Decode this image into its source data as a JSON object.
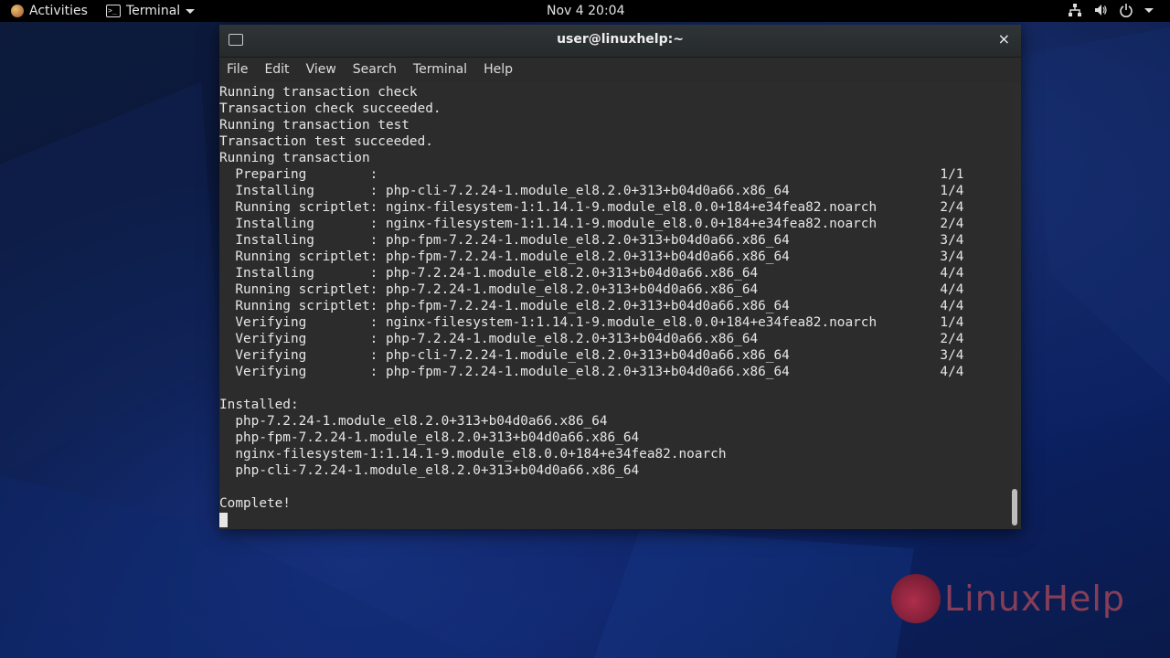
{
  "topbar": {
    "activities_label": "Activities",
    "app_menu_label": "Terminal",
    "clock": "Nov 4  20:04"
  },
  "window": {
    "title": "user@linuxhelp:~",
    "close_glyph": "×",
    "menu": [
      "File",
      "Edit",
      "View",
      "Search",
      "Terminal",
      "Help"
    ]
  },
  "terminal": {
    "lines": [
      "Running transaction check",
      "Transaction check succeeded.",
      "Running transaction test",
      "Transaction test succeeded.",
      "Running transaction",
      "  Preparing        :                                                                       1/1",
      "  Installing       : php-cli-7.2.24-1.module_el8.2.0+313+b04d0a66.x86_64                   1/4",
      "  Running scriptlet: nginx-filesystem-1:1.14.1-9.module_el8.0.0+184+e34fea82.noarch        2/4",
      "  Installing       : nginx-filesystem-1:1.14.1-9.module_el8.0.0+184+e34fea82.noarch        2/4",
      "  Installing       : php-fpm-7.2.24-1.module_el8.2.0+313+b04d0a66.x86_64                   3/4",
      "  Running scriptlet: php-fpm-7.2.24-1.module_el8.2.0+313+b04d0a66.x86_64                   3/4",
      "  Installing       : php-7.2.24-1.module_el8.2.0+313+b04d0a66.x86_64                       4/4",
      "  Running scriptlet: php-7.2.24-1.module_el8.2.0+313+b04d0a66.x86_64                       4/4",
      "  Running scriptlet: php-fpm-7.2.24-1.module_el8.2.0+313+b04d0a66.x86_64                   4/4",
      "  Verifying        : nginx-filesystem-1:1.14.1-9.module_el8.0.0+184+e34fea82.noarch        1/4",
      "  Verifying        : php-7.2.24-1.module_el8.2.0+313+b04d0a66.x86_64                       2/4",
      "  Verifying        : php-cli-7.2.24-1.module_el8.2.0+313+b04d0a66.x86_64                   3/4",
      "  Verifying        : php-fpm-7.2.24-1.module_el8.2.0+313+b04d0a66.x86_64                   4/4",
      "",
      "Installed:",
      "  php-7.2.24-1.module_el8.2.0+313+b04d0a66.x86_64",
      "  php-fpm-7.2.24-1.module_el8.2.0+313+b04d0a66.x86_64",
      "  nginx-filesystem-1:1.14.1-9.module_el8.0.0+184+e34fea82.noarch",
      "  php-cli-7.2.24-1.module_el8.2.0+313+b04d0a66.x86_64",
      "",
      "Complete!"
    ]
  },
  "watermark": {
    "text": "LinuxHelp"
  },
  "colors": {
    "terminal_bg": "#2c2c2c",
    "terminal_fg": "#e6e6e6",
    "topbar_bg": "#000000",
    "logo_accent": "#b04a5a"
  }
}
